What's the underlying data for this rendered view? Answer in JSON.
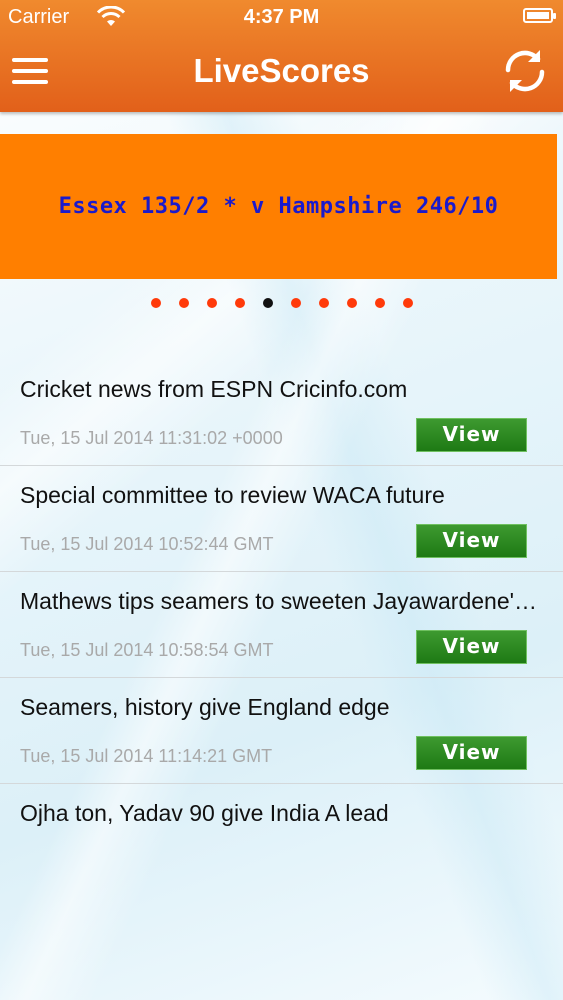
{
  "status_bar": {
    "carrier": "Carrier",
    "time": "4:37 PM"
  },
  "header": {
    "title": "LiveScores",
    "menu_icon": "hamburger-menu-icon",
    "refresh_icon": "refresh-icon"
  },
  "banner": {
    "text": "Essex 135/2 * v Hampshire 246/10"
  },
  "pager": {
    "total": 10,
    "active_index": 4
  },
  "news": [
    {
      "title": "Cricket news from ESPN Cricinfo.com",
      "date": "Tue, 15 Jul 2014 11:31:02 +0000",
      "button": "View"
    },
    {
      "title": "Special committee to review WACA future",
      "date": "Tue, 15 Jul 2014 10:52:44 GMT",
      "button": "View"
    },
    {
      "title": "Mathews tips seamers to sweeten Jayawardene's farewell",
      "date": "Tue, 15 Jul 2014 10:58:54 GMT",
      "button": "View"
    },
    {
      "title": "Seamers, history give England edge",
      "date": "Tue, 15 Jul 2014 11:14:21 GMT",
      "button": "View"
    },
    {
      "title": "Ojha ton, Yadav 90 give India A lead",
      "date": "",
      "button": ""
    }
  ],
  "colors": {
    "header": "#e8701f",
    "banner": "#ff7f00",
    "banner_text": "#1a1acc",
    "dot": "#ff3a0a",
    "dot_active": "#111111",
    "view_button": "#2a8a1e"
  }
}
